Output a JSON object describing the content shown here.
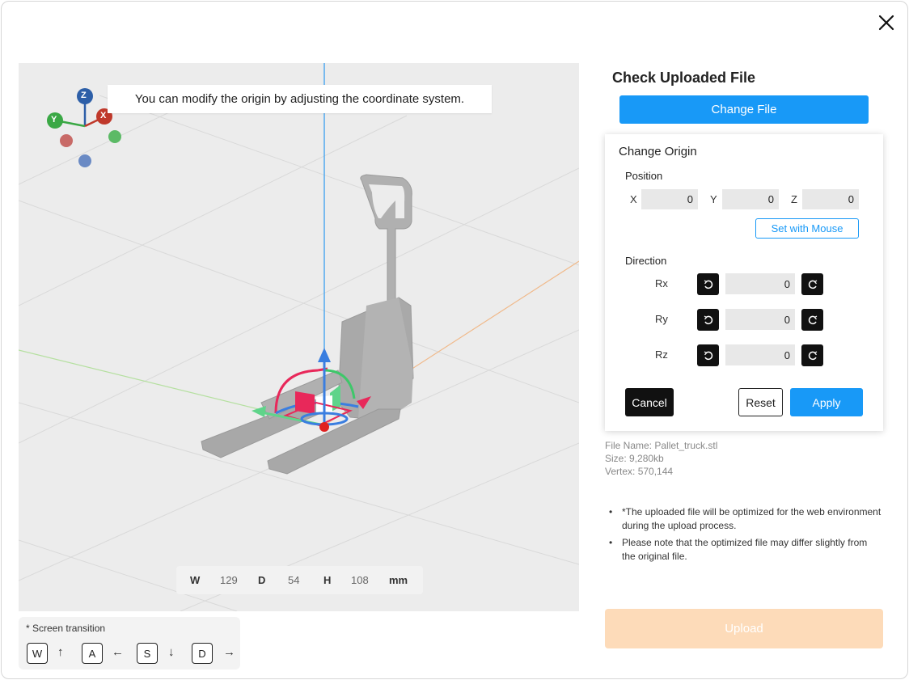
{
  "viewport": {
    "hint": "You can modify the origin by adjusting the coordinate system.",
    "gizmo": {
      "z": "Z",
      "y": "Y",
      "x": "X"
    },
    "dimensions": {
      "w_label": "W",
      "w_value": "129",
      "d_label": "D",
      "d_value": "54",
      "h_label": "H",
      "h_value": "108",
      "unit": "mm"
    }
  },
  "screen_transition": {
    "title": "* Screen transition",
    "keys": [
      {
        "key": "W",
        "arrow": "↑"
      },
      {
        "key": "A",
        "arrow": "←"
      },
      {
        "key": "S",
        "arrow": "↓"
      },
      {
        "key": "D",
        "arrow": "→"
      }
    ]
  },
  "panel": {
    "title": "Check Uploaded File",
    "change_file": "Change File",
    "origin": {
      "title": "Change Origin",
      "position_label": "Position",
      "x_label": "X",
      "x_value": "0",
      "y_label": "Y",
      "y_value": "0",
      "z_label": "Z",
      "z_value": "0",
      "set_with_mouse": "Set with Mouse",
      "direction_label": "Direction",
      "rx_label": "Rx",
      "rx_value": "0",
      "ry_label": "Ry",
      "ry_value": "0",
      "rz_label": "Rz",
      "rz_value": "0",
      "cancel": "Cancel",
      "reset": "Reset",
      "apply": "Apply"
    },
    "file_info": {
      "name": "File Name: Pallet_truck.stl",
      "size": "Size: 9,280kb",
      "vertex": "Vertex: 570,144"
    },
    "notes": [
      "*The uploaded file will be optimized for the web environment during the upload process.",
      "Please note that the optimized file may differ slightly from the original file."
    ],
    "upload": "Upload"
  },
  "colors": {
    "accent": "#1899f7",
    "upload_disabled": "#fddbb9",
    "axis_x": "#c0392b",
    "axis_y": "#3aa845",
    "axis_z": "#2d5fa8"
  }
}
